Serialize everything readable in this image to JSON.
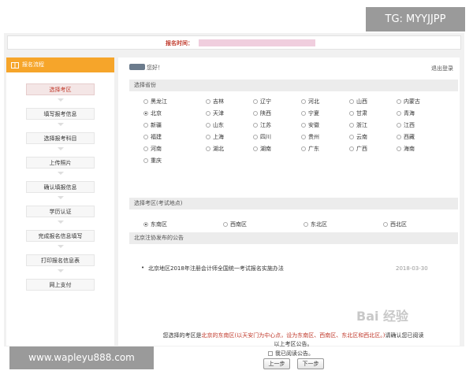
{
  "watermarks": {
    "tg": "TG: MYYJJPP",
    "site": "www.wapleyu888.com",
    "baidu": "Bai 经验"
  },
  "header": {
    "time_label": "报名时间："
  },
  "sidebar": {
    "title": "报名流程",
    "steps": [
      {
        "label": "选择考区",
        "active": true
      },
      {
        "label": "填写报考信息",
        "active": false
      },
      {
        "label": "选择报考科目",
        "active": false
      },
      {
        "label": "上传照片",
        "active": false
      },
      {
        "label": "确认填报信息",
        "active": false
      },
      {
        "label": "学历认证",
        "active": false
      },
      {
        "label": "完成报名信息填写",
        "active": false
      },
      {
        "label": "打印报名信息表",
        "active": false
      },
      {
        "label": "网上支付",
        "active": false
      }
    ]
  },
  "main": {
    "greeting": "您好！",
    "logout": "退出登录",
    "province_section": "选择省份",
    "provinces": [
      [
        "黑龙江",
        "吉林",
        "辽宁",
        "河北",
        "山西",
        "内蒙古"
      ],
      [
        "北京",
        "天津",
        "陕西",
        "宁夏",
        "甘肃",
        "青海"
      ],
      [
        "新疆",
        "山东",
        "江苏",
        "安徽",
        "浙江",
        "江西"
      ],
      [
        "福建",
        "上海",
        "四川",
        "贵州",
        "云南",
        "西藏"
      ],
      [
        "河南",
        "湖北",
        "湖南",
        "广东",
        "广西",
        "海南"
      ],
      [
        "重庆"
      ]
    ],
    "selected_province": "北京",
    "district_section": "选择考区(考试地点)",
    "districts": [
      "东南区",
      "西南区",
      "东北区",
      "西北区"
    ],
    "selected_district": "东南区",
    "notice_section": "北京注协发布的公告",
    "notices": [
      {
        "title": "北京地区2018年注册会计师全国统一考试报名实施办法",
        "date": "2018-03-30"
      }
    ],
    "bottom": {
      "part1": "您选择的考区是",
      "part2": "北京的东南区(以天安门为中心点，设为东南区、西南区、东北区和西北区。)",
      "part3": "请确认您已阅读",
      "line2": "以上考区公告。",
      "confirm": "我已阅读公告。"
    },
    "buttons": {
      "prev": "上一步",
      "next": "下一步"
    }
  }
}
